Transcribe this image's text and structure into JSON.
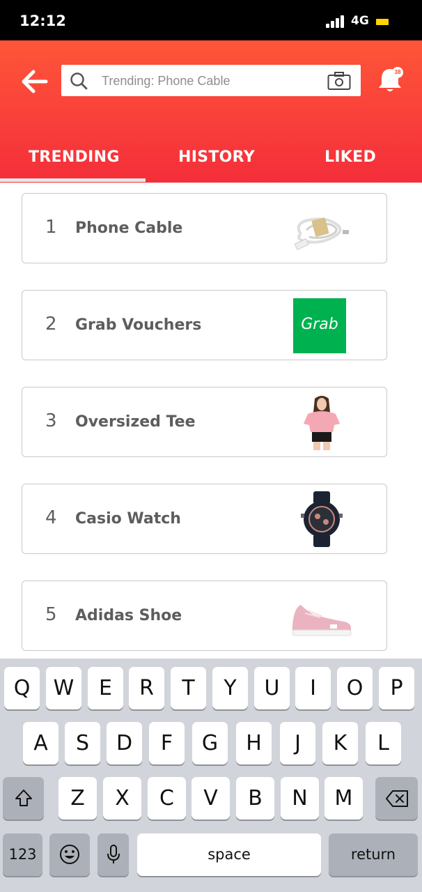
{
  "status_bar": {
    "time": "12:12",
    "network": "4G"
  },
  "header": {
    "search_placeholder": "Trending: Phone Cable",
    "notification_count": "38",
    "tabs": [
      {
        "label": "TRENDING",
        "active": true
      },
      {
        "label": "HISTORY",
        "active": false
      },
      {
        "label": "LIKED",
        "active": false
      }
    ]
  },
  "trending": [
    {
      "rank": "1",
      "label": "Phone Cable",
      "thumbnail": "phone-cable"
    },
    {
      "rank": "2",
      "label": "Grab Vouchers",
      "thumbnail": "grab-logo",
      "logo_text": "Grab"
    },
    {
      "rank": "3",
      "label": "Oversized Tee",
      "thumbnail": "oversized-tee"
    },
    {
      "rank": "4",
      "label": "Casio Watch",
      "thumbnail": "casio-watch"
    },
    {
      "rank": "5",
      "label": "Adidas Shoe",
      "thumbnail": "adidas-shoe"
    }
  ],
  "keyboard": {
    "row1": [
      "Q",
      "W",
      "E",
      "R",
      "T",
      "Y",
      "U",
      "I",
      "O",
      "P"
    ],
    "row2": [
      "A",
      "S",
      "D",
      "F",
      "G",
      "H",
      "J",
      "K",
      "L"
    ],
    "row3": [
      "Z",
      "X",
      "C",
      "V",
      "B",
      "N",
      "M"
    ],
    "numbers_label": "123",
    "space_label": "space",
    "return_label": "return"
  },
  "colors": {
    "brand_gradient_top": "#fe5638",
    "brand_gradient_bottom": "#f42e3a",
    "grab_green": "#00b14f",
    "text": "#5d5d5d"
  }
}
